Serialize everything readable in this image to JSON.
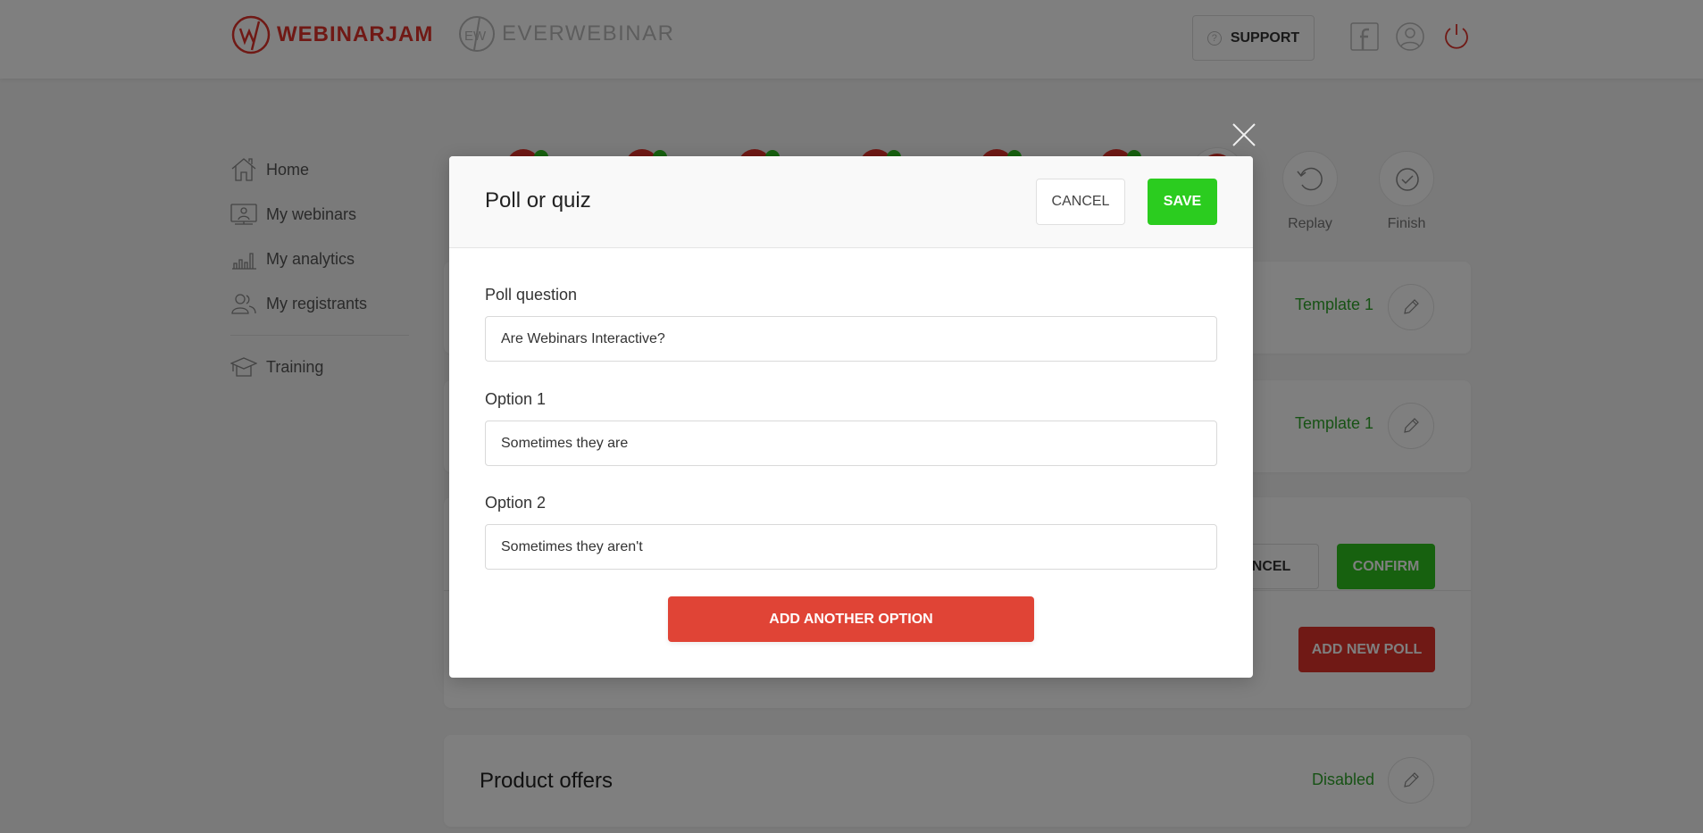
{
  "header": {
    "brand_primary": "WEBINARJAM",
    "brand_secondary": "EVERWEBINAR",
    "support_label": "SUPPORT",
    "icons": [
      "question-icon",
      "facebook-icon",
      "user-icon",
      "power-icon"
    ]
  },
  "sidebar": {
    "items": [
      {
        "label": "Home",
        "icon": "home-icon"
      },
      {
        "label": "My webinars",
        "icon": "monitor-presenter-icon"
      },
      {
        "label": "My analytics",
        "icon": "bar-chart-icon"
      },
      {
        "label": "My registrants",
        "icon": "users-icon"
      },
      {
        "label": "Training",
        "icon": "graduation-cap-icon"
      }
    ]
  },
  "steps": {
    "visible_labels": [
      "Replay",
      "Finish"
    ]
  },
  "cards": [
    {
      "status": "Template 1"
    },
    {
      "status": "Template 1"
    },
    {
      "cancel_label": "CANCEL",
      "confirm_label": "CONFIRM",
      "add_poll_label": "ADD NEW POLL"
    },
    {
      "title": "Product offers",
      "status": "Disabled"
    }
  ],
  "modal": {
    "title": "Poll or quiz",
    "cancel_label": "CANCEL",
    "save_label": "SAVE",
    "fields": [
      {
        "label": "Poll question",
        "value": "Are Webinars Interactive?"
      },
      {
        "label": "Option 1",
        "value": "Sometimes they are"
      },
      {
        "label": "Option 2",
        "value": "Sometimes they aren't"
      }
    ],
    "add_option_label": "ADD ANOTHER OPTION"
  },
  "colors": {
    "brand_red": "#e0332a",
    "save_green": "#2bcc1f",
    "status_green": "#2fa52a",
    "add_option_red": "#e04436"
  }
}
